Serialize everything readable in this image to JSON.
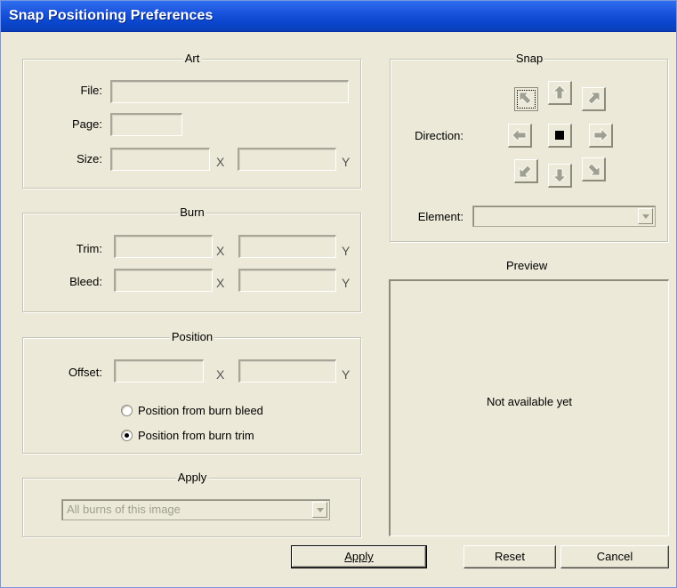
{
  "window": {
    "title": "Snap Positioning Preferences"
  },
  "art": {
    "legend": "Art",
    "file_label": "File:",
    "file_value": "",
    "page_label": "Page:",
    "page_value": "",
    "size_label": "Size:",
    "size_x_value": "",
    "size_y_value": "",
    "x": "X",
    "y": "Y"
  },
  "burn": {
    "legend": "Burn",
    "trim_label": "Trim:",
    "trim_x_value": "",
    "trim_y_value": "",
    "bleed_label": "Bleed:",
    "bleed_x_value": "",
    "bleed_y_value": "",
    "x": "X",
    "y": "Y"
  },
  "position": {
    "legend": "Position",
    "offset_label": "Offset:",
    "offset_x_value": "",
    "offset_y_value": "",
    "x": "X",
    "y": "Y",
    "radio_bleed": "Position from burn bleed",
    "radio_trim": "Position from burn trim",
    "selected": "trim"
  },
  "apply_group": {
    "legend": "Apply",
    "selected_option": "All burns of this image"
  },
  "snap": {
    "legend": "Snap",
    "direction_label": "Direction:",
    "selected_direction": "up-left",
    "element_label": "Element:",
    "element_value": ""
  },
  "preview": {
    "title": "Preview",
    "message": "Not available yet"
  },
  "buttons": {
    "apply": "Apply",
    "reset": "Reset",
    "cancel": "Cancel"
  },
  "icons": [
    "arrow-up-left-icon",
    "arrow-up-icon",
    "arrow-up-right-icon",
    "arrow-left-icon",
    "center-square-icon",
    "arrow-right-icon",
    "arrow-down-left-icon",
    "arrow-down-icon",
    "arrow-down-right-icon",
    "dropdown-arrow-icon"
  ]
}
